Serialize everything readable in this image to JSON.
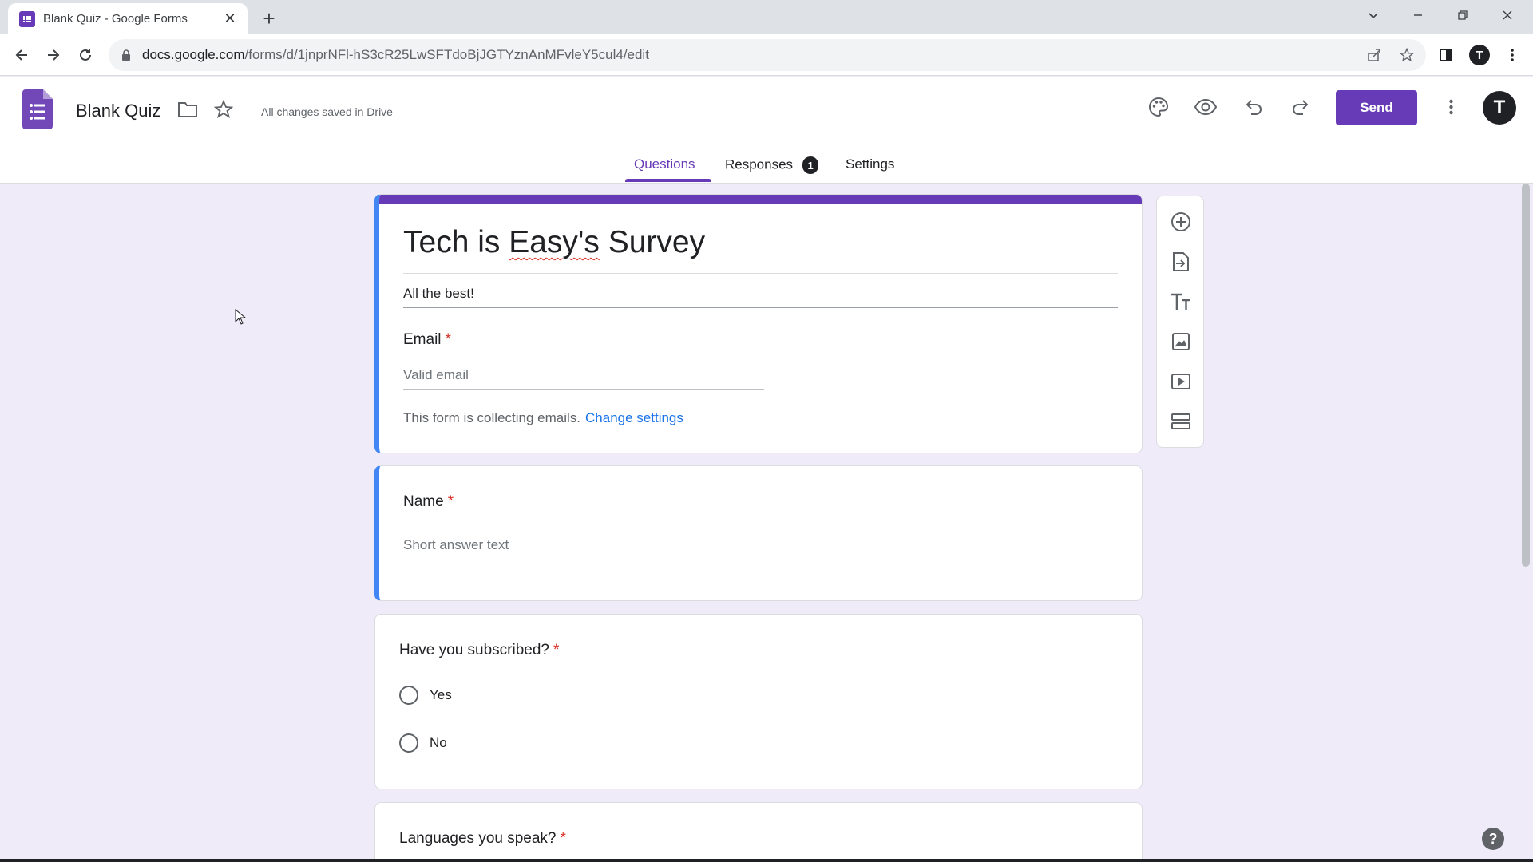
{
  "browser": {
    "tab_title": "Blank Quiz - Google Forms",
    "url_host": "docs.google.com",
    "url_path": "/forms/d/1jnprNFl-hS3cR25LwSFTdoBjJGTYznAnMFvleY5cul4/edit",
    "profile_initial": "T"
  },
  "app": {
    "doc_title": "Blank Quiz",
    "save_status": "All changes saved in Drive",
    "send_label": "Send",
    "avatar_initial": "T",
    "accent_color": "#673ab7"
  },
  "tabs": {
    "questions": "Questions",
    "responses": "Responses",
    "responses_count": "1",
    "settings": "Settings"
  },
  "form": {
    "title_pre": "Tech is ",
    "title_underlined": "Easy's",
    "title_post": " Survey",
    "description": "All the best!",
    "email_label": "Email",
    "email_placeholder": "Valid email",
    "collecting_text": "This form is collecting emails.",
    "change_settings": "Change settings",
    "required_marker": "*"
  },
  "questions": [
    {
      "label": "Name",
      "placeholder": "Short answer text"
    },
    {
      "label": "Have you subscribed?",
      "options": [
        "Yes",
        "No"
      ]
    },
    {
      "label": "Languages you speak?"
    }
  ],
  "icons": {
    "side_toolbar": [
      "add-question-icon",
      "import-questions-icon",
      "add-title-icon",
      "add-image-icon",
      "add-video-icon",
      "add-section-icon"
    ],
    "header": [
      "palette-icon",
      "preview-icon",
      "undo-icon",
      "redo-icon",
      "more-vert-icon"
    ]
  }
}
